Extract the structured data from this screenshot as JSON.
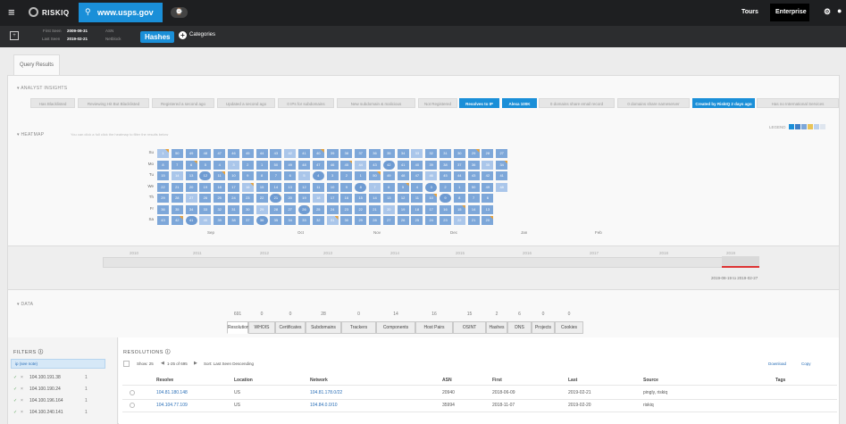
{
  "topbar": {
    "logo": "RISKIQ",
    "search_query": "www.usps.gov",
    "tours": "Tours",
    "enterprise": "Enterprise"
  },
  "subbar": {
    "first_seen_label": "First Seen",
    "first_seen": "2009-09-31",
    "last_seen_label": "Last Seen",
    "last_seen": "2019-02-21",
    "asn_label": "ASN",
    "netblock_label": "Netblock",
    "hashes": "Hashes",
    "categories": "Categories"
  },
  "tabs": {
    "query_results": "Query Results"
  },
  "insights": {
    "label": "ANALYST INSIGHTS",
    "items": [
      {
        "text": "Has Blacklisted",
        "on": false
      },
      {
        "text": "Reviewing Hit But Blacklisted",
        "on": false
      },
      {
        "text": "Registered a second ago",
        "on": false
      },
      {
        "text": "Updated a second ago",
        "on": false
      },
      {
        "text": "0 IPs for subdomains",
        "on": false
      },
      {
        "text": "New subdomain & malicious",
        "on": false
      },
      {
        "text": "Not Registered",
        "on": false
      },
      {
        "text": "Resolves to IP",
        "on": true
      },
      {
        "text": "Alexa 100K",
        "on": true
      },
      {
        "text": "0 domains share email record",
        "on": false
      },
      {
        "text": "0 domains share nameserver",
        "on": false
      },
      {
        "text": "Created by RiskIQ 2 days ago",
        "on": true
      },
      {
        "text": "Has no International Services",
        "on": false
      }
    ]
  },
  "heatmap": {
    "label": "HEATMAP",
    "hint": "You can click a full click the heatmap to filter the results below",
    "legend": "LEGEND",
    "days": [
      "Su",
      "Mo",
      "Tu",
      "We",
      "Th",
      "Fr",
      "Sa"
    ],
    "months": [
      "Sep",
      "Oct",
      "Nov",
      "Dec",
      "Jan",
      "Feb"
    ]
  },
  "timeline": {
    "years": [
      "2010",
      "2011",
      "2012",
      "2013",
      "2014",
      "2015",
      "2016",
      "2017",
      "2018",
      "2019"
    ],
    "range": "2019-08-19 to 2019-02-27"
  },
  "data_label": "DATA",
  "data_tabs": [
    {
      "label": "Resolutions",
      "count": "691",
      "active": true
    },
    {
      "label": "WHOIS",
      "count": "0"
    },
    {
      "label": "Certificates",
      "count": "0"
    },
    {
      "label": "Subdomains",
      "count": "28"
    },
    {
      "label": "Trackers",
      "count": "0"
    },
    {
      "label": "Components",
      "count": "14"
    },
    {
      "label": "Host Pairs",
      "count": "16"
    },
    {
      "label": "OSINT",
      "count": "15"
    },
    {
      "label": "Hashes",
      "count": "2"
    },
    {
      "label": "DNS",
      "count": "6"
    },
    {
      "label": "Projects",
      "count": "0"
    },
    {
      "label": "Cookies",
      "count": "0"
    }
  ],
  "filters": {
    "title": "FILTERS",
    "selected": "ip (see note)",
    "items": [
      {
        "label": "104.100.191.38",
        "count": "1"
      },
      {
        "label": "104.100.190.24",
        "count": "1"
      },
      {
        "label": "104.100.196.164",
        "count": "1"
      },
      {
        "label": "104.100.240.141",
        "count": "1"
      }
    ]
  },
  "resolutions": {
    "title": "RESOLUTIONS",
    "show": "Show: 25",
    "paging": "1-25 of 695",
    "sort": "Sort: Last Seen Descending",
    "download": "Download",
    "copy": "Copy",
    "columns": [
      "Resolve",
      "Location",
      "Network",
      "ASN",
      "First",
      "Last",
      "Source",
      "Tags"
    ],
    "rows": [
      {
        "resolve": "104.81.180.148",
        "location": "US",
        "network": "104.81.178.0/22",
        "asn": "20940",
        "first": "2018-06-09",
        "last": "2019-02-21",
        "source": "pingly, riskiq"
      },
      {
        "resolve": "104.104.77.109",
        "location": "US",
        "network": "104.84.0.0/10",
        "asn": "35994",
        "first": "2018-11-07",
        "last": "2019-02-20",
        "source": "riskiq"
      }
    ]
  },
  "colors": {
    "accent": "#1a8fd8",
    "cell": "#7da7d9",
    "topbar": "#1e1f21"
  }
}
